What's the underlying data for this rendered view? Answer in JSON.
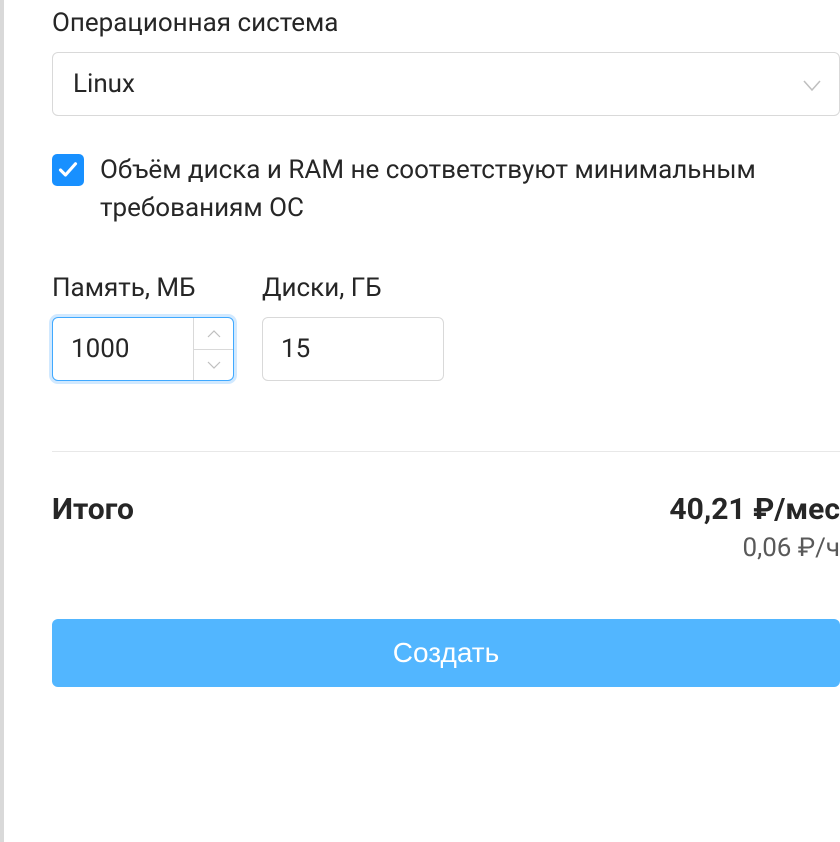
{
  "os": {
    "label": "Операционная система",
    "value": "Linux"
  },
  "requirements_warning": {
    "checked": true,
    "text": "Объём диска и RAM не соответствуют минимальным требованиям ОС"
  },
  "memory": {
    "label": "Память, МБ",
    "value": "1000"
  },
  "disk": {
    "label": "Диски, ГБ",
    "value": "15"
  },
  "total": {
    "label": "Итого",
    "price_monthly": "40,21 ₽/мес",
    "price_hourly": "0,06 ₽/ч"
  },
  "create_button": "Создать"
}
